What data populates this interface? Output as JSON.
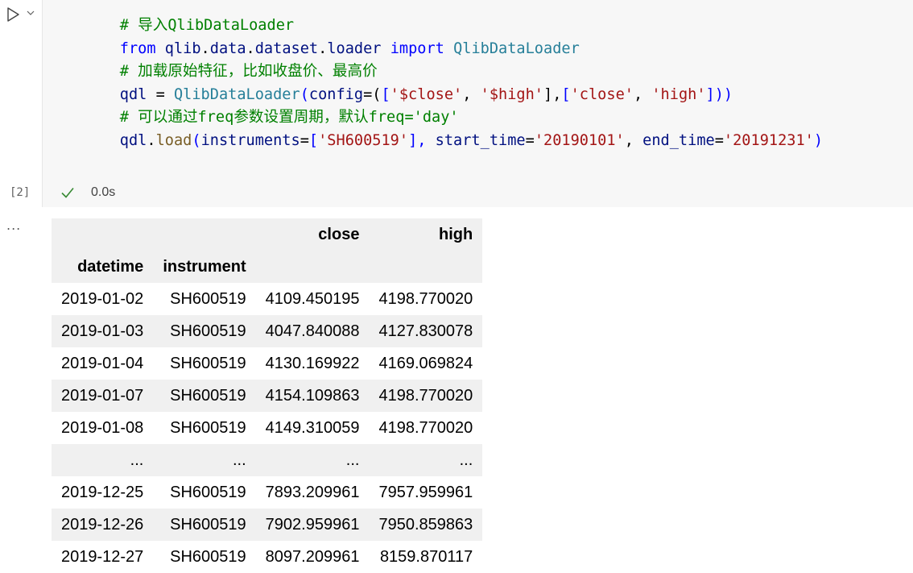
{
  "cell": {
    "code_lines": [
      [
        {
          "t": "    ",
          "c": ""
        },
        {
          "t": "# 导入QlibDataLoader",
          "c": "cm"
        }
      ],
      [
        {
          "t": "    ",
          "c": ""
        },
        {
          "t": "from",
          "c": "kw"
        },
        {
          "t": " ",
          "c": ""
        },
        {
          "t": "qlib",
          "c": "vr"
        },
        {
          "t": ".",
          "c": ""
        },
        {
          "t": "data",
          "c": "vr"
        },
        {
          "t": ".",
          "c": ""
        },
        {
          "t": "dataset",
          "c": "vr"
        },
        {
          "t": ".",
          "c": ""
        },
        {
          "t": "loader",
          "c": "vr"
        },
        {
          "t": " ",
          "c": ""
        },
        {
          "t": "import",
          "c": "kw"
        },
        {
          "t": " ",
          "c": ""
        },
        {
          "t": "QlibDataLoader",
          "c": "cls"
        }
      ],
      [
        {
          "t": "    ",
          "c": ""
        },
        {
          "t": "# 加载原始特征，比如收盘价、最高价",
          "c": "cm"
        }
      ],
      [
        {
          "t": "    ",
          "c": ""
        },
        {
          "t": "qdl",
          "c": "vr"
        },
        {
          "t": " = ",
          "c": ""
        },
        {
          "t": "QlibDataLoader",
          "c": "cls"
        },
        {
          "t": "(",
          "c": "kw"
        },
        {
          "t": "config",
          "c": "vr"
        },
        {
          "t": "=(",
          "c": ""
        },
        {
          "t": "[",
          "c": "kw"
        },
        {
          "t": "'$close'",
          "c": "st"
        },
        {
          "t": ", ",
          "c": ""
        },
        {
          "t": "'$high'",
          "c": "st"
        },
        {
          "t": "],",
          "c": ""
        },
        {
          "t": "[",
          "c": "kw"
        },
        {
          "t": "'close'",
          "c": "st"
        },
        {
          "t": ", ",
          "c": ""
        },
        {
          "t": "'high'",
          "c": "st"
        },
        {
          "t": "]))",
          "c": "kw"
        }
      ],
      [
        {
          "t": "    ",
          "c": ""
        },
        {
          "t": "# 可以通过freq参数设置周期，默认freq='day'",
          "c": "cm"
        }
      ],
      [
        {
          "t": "    ",
          "c": ""
        },
        {
          "t": "qdl",
          "c": "vr"
        },
        {
          "t": ".",
          "c": ""
        },
        {
          "t": "load",
          "c": "fn"
        },
        {
          "t": "(",
          "c": "kw"
        },
        {
          "t": "instruments",
          "c": "vr"
        },
        {
          "t": "=",
          "c": ""
        },
        {
          "t": "[",
          "c": "kw"
        },
        {
          "t": "'SH600519'",
          "c": "st"
        },
        {
          "t": "], ",
          "c": "kw"
        },
        {
          "t": "start_time",
          "c": "vr"
        },
        {
          "t": "=",
          "c": ""
        },
        {
          "t": "'20190101'",
          "c": "st"
        },
        {
          "t": ", ",
          "c": ""
        },
        {
          "t": "end_time",
          "c": "vr"
        },
        {
          "t": "=",
          "c": ""
        },
        {
          "t": "'20191231'",
          "c": "st"
        },
        {
          "t": ")",
          "c": "kw"
        }
      ]
    ],
    "exec_count": "[2]",
    "exec_time": "0.0s",
    "colors": {
      "success": "#388a34",
      "comment": "#008000",
      "keyword": "#0000ff",
      "string": "#a31515"
    }
  },
  "output": {
    "more_label": "...",
    "header": {
      "columns": [
        "",
        "",
        "close",
        "high"
      ],
      "index_names": [
        "datetime",
        "instrument",
        "",
        ""
      ]
    },
    "rows": [
      [
        "2019-01-02",
        "SH600519",
        "4109.450195",
        "4198.770020"
      ],
      [
        "2019-01-03",
        "SH600519",
        "4047.840088",
        "4127.830078"
      ],
      [
        "2019-01-04",
        "SH600519",
        "4130.169922",
        "4169.069824"
      ],
      [
        "2019-01-07",
        "SH600519",
        "4154.109863",
        "4198.770020"
      ],
      [
        "2019-01-08",
        "SH600519",
        "4149.310059",
        "4198.770020"
      ],
      [
        "...",
        "...",
        "...",
        "..."
      ],
      [
        "2019-12-25",
        "SH600519",
        "7893.209961",
        "7957.959961"
      ],
      [
        "2019-12-26",
        "SH600519",
        "7902.959961",
        "7950.859863"
      ],
      [
        "2019-12-27",
        "SH600519",
        "8097.209961",
        "8159.870117"
      ]
    ]
  }
}
